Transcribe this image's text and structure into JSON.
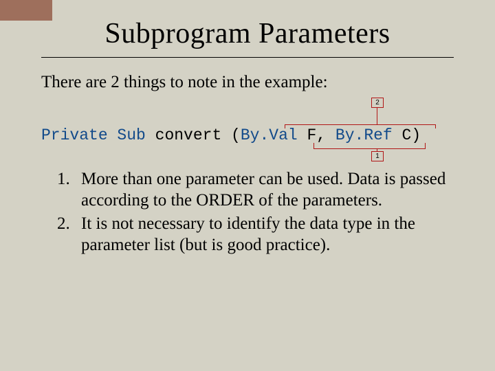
{
  "title": "Subprogram Parameters",
  "intro": "There are 2 things to note in the example:",
  "code": {
    "kw1": "Private Sub ",
    "name": "convert (",
    "kw2": "By.Val ",
    "p1": "F, ",
    "kw3": "By.Ref ",
    "p2": "C)"
  },
  "callouts": {
    "top": "2",
    "bottom": "1"
  },
  "points": {
    "p1": "More than one parameter can be used. Data is passed according to the ORDER of the parameters.",
    "p2": "It is not necessary to identify the data type in the parameter list (but is good practice)."
  }
}
